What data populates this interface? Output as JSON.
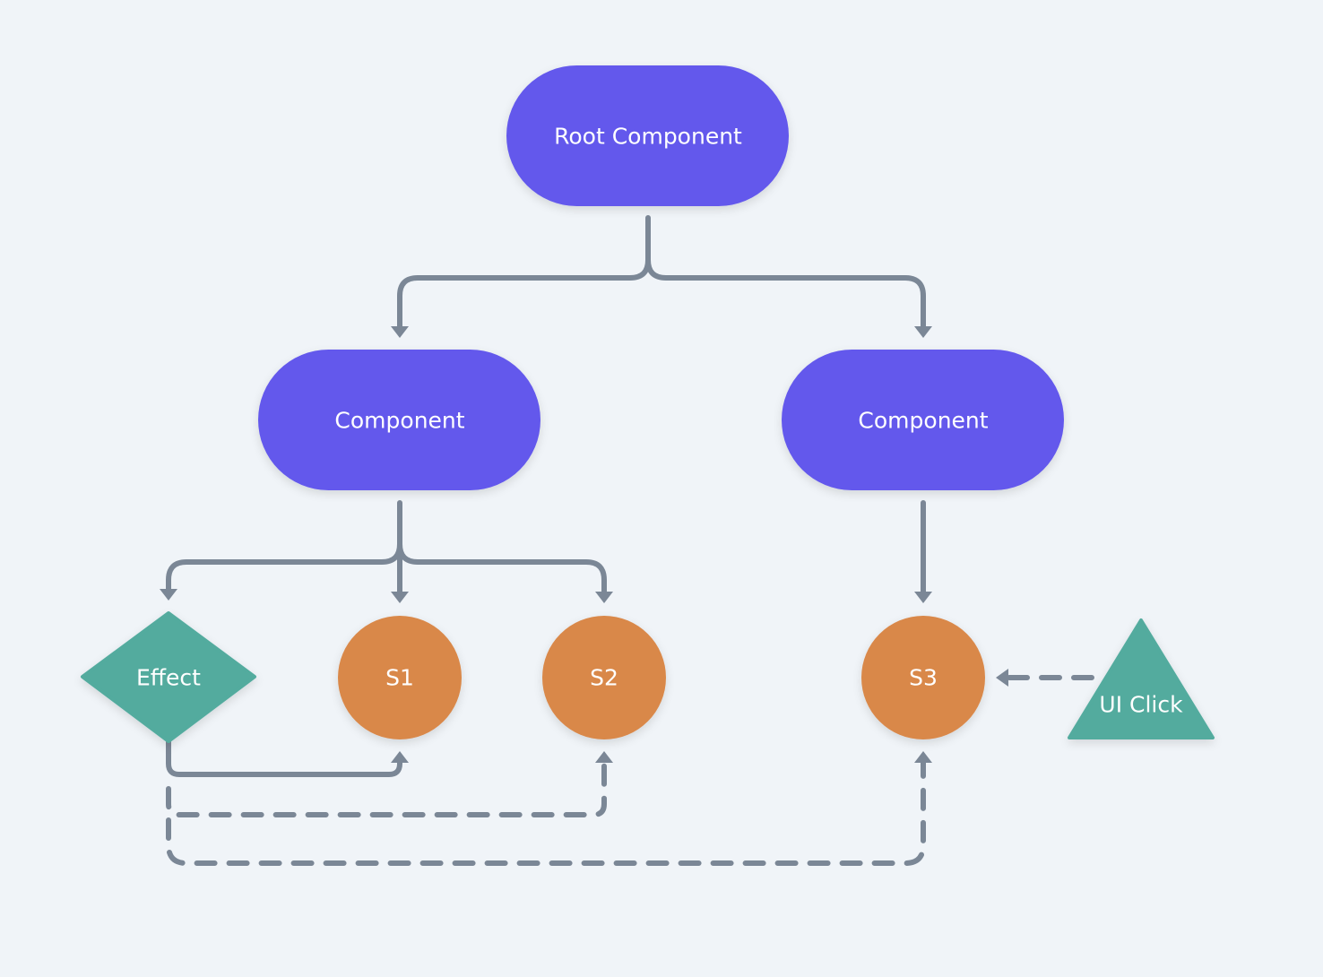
{
  "colors": {
    "background": "#f0f4f8",
    "component": "#6359ec",
    "state": "#d9884a",
    "effect": "#52ab9e",
    "edge": "#7b8796"
  },
  "nodes": {
    "root": {
      "label": "Root Component",
      "shape": "pill"
    },
    "component_left": {
      "label": "Component",
      "shape": "pill"
    },
    "component_right": {
      "label": "Component",
      "shape": "pill"
    },
    "effect": {
      "label": "Effect",
      "shape": "diamond"
    },
    "s1": {
      "label": "S1",
      "shape": "circle"
    },
    "s2": {
      "label": "S2",
      "shape": "circle"
    },
    "s3": {
      "label": "S3",
      "shape": "circle"
    },
    "ui_click": {
      "label": "UI Click",
      "shape": "triangle"
    }
  },
  "edges": [
    {
      "from": "root",
      "to": "component_left",
      "style": "solid"
    },
    {
      "from": "root",
      "to": "component_right",
      "style": "solid"
    },
    {
      "from": "component_left",
      "to": "effect",
      "style": "solid"
    },
    {
      "from": "component_left",
      "to": "s1",
      "style": "solid"
    },
    {
      "from": "component_left",
      "to": "s2",
      "style": "solid"
    },
    {
      "from": "component_right",
      "to": "s3",
      "style": "solid"
    },
    {
      "from": "effect",
      "to": "s1",
      "style": "dashed"
    },
    {
      "from": "effect",
      "to": "s2",
      "style": "dashed"
    },
    {
      "from": "effect",
      "to": "s3",
      "style": "dashed"
    },
    {
      "from": "ui_click",
      "to": "s3",
      "style": "dashed"
    }
  ]
}
